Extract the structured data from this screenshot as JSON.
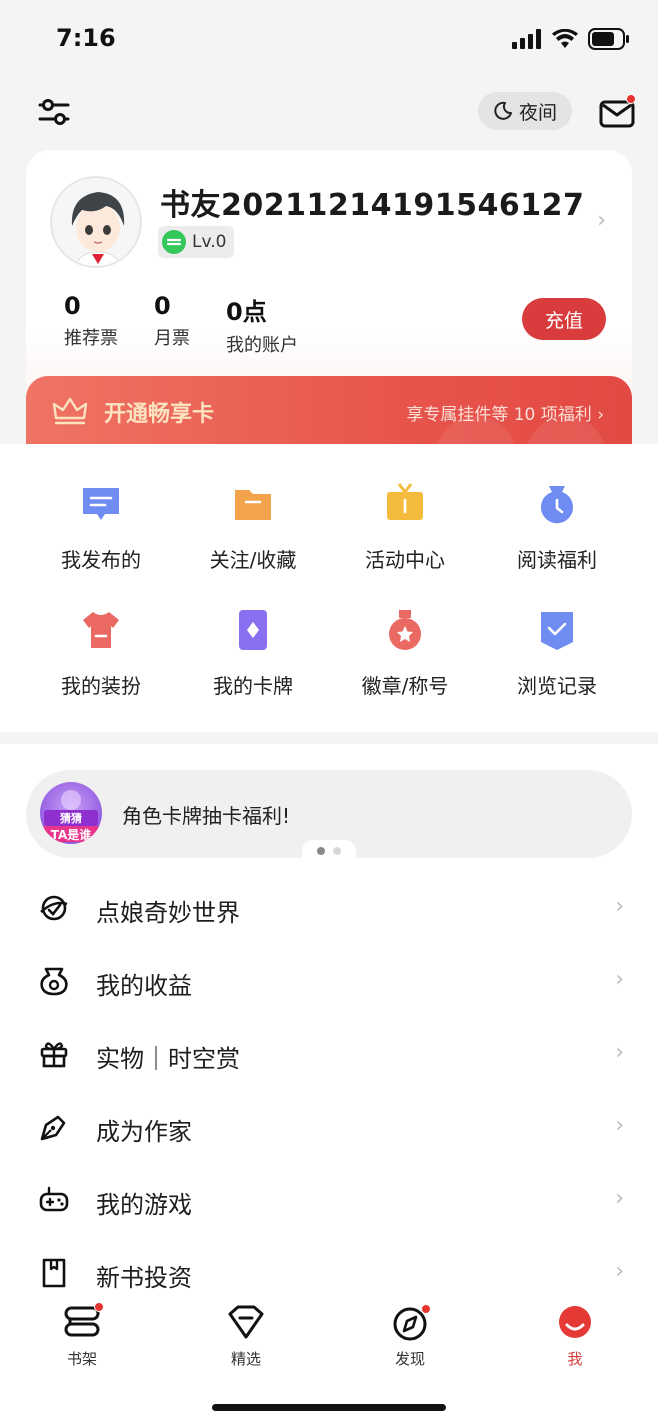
{
  "status_bar": {
    "time": "7:16"
  },
  "top_bar": {
    "night_label": "夜间"
  },
  "profile": {
    "username": "书友20211214191546127",
    "level": "Lv.0",
    "stats": [
      {
        "value": "0",
        "label": "推荐票"
      },
      {
        "value": "0",
        "label": "月票"
      },
      {
        "value": "0点",
        "label": "我的账户"
      }
    ],
    "recharge_label": "充值"
  },
  "vip": {
    "title": "开通畅享卡",
    "subtitle": "享专属挂件等 10 项福利"
  },
  "grid": [
    {
      "label": "我发布的",
      "icon": "chat-bubble-icon",
      "color": "#6f8cf3"
    },
    {
      "label": "关注/收藏",
      "icon": "folder-icon",
      "color": "#f2a34b"
    },
    {
      "label": "活动中心",
      "icon": "gift-box-icon",
      "color": "#f4bb3d"
    },
    {
      "label": "阅读福利",
      "icon": "clock-bag-icon",
      "color": "#6f8cf3"
    },
    {
      "label": "我的装扮",
      "icon": "tshirt-icon",
      "color": "#ea6a63"
    },
    {
      "label": "我的卡牌",
      "icon": "card-icon",
      "color": "#8a6ff0"
    },
    {
      "label": "徽章/称号",
      "icon": "medal-icon",
      "color": "#ea6a63"
    },
    {
      "label": "浏览记录",
      "icon": "history-icon",
      "color": "#6f8cf3"
    }
  ],
  "promo": {
    "text": "角色卡牌抽卡福利!",
    "avatar_text": [
      "猜猜",
      "TA是谁"
    ]
  },
  "menu": [
    {
      "label": "点娘奇妙世界",
      "icon": "world-icon"
    },
    {
      "label": "我的收益",
      "icon": "money-bag-icon"
    },
    {
      "label": "实物｜时空赏",
      "icon": "gift-icon"
    },
    {
      "label": "成为作家",
      "icon": "pen-icon"
    },
    {
      "label": "我的游戏",
      "icon": "gamepad-icon"
    },
    {
      "label": "新书投资",
      "icon": "bookmark-icon"
    }
  ],
  "tabs": [
    {
      "label": "书架",
      "icon": "bookshelf-icon",
      "dot": true
    },
    {
      "label": "精选",
      "icon": "diamond-icon",
      "dot": false
    },
    {
      "label": "发现",
      "icon": "compass-icon",
      "dot": true
    },
    {
      "label": "我",
      "icon": "me-icon",
      "dot": false,
      "active": true
    }
  ],
  "colors": {
    "accent": "#d93c3c",
    "vip_gradient_start": "#ef7465",
    "vip_gradient_end": "#e24a44"
  }
}
